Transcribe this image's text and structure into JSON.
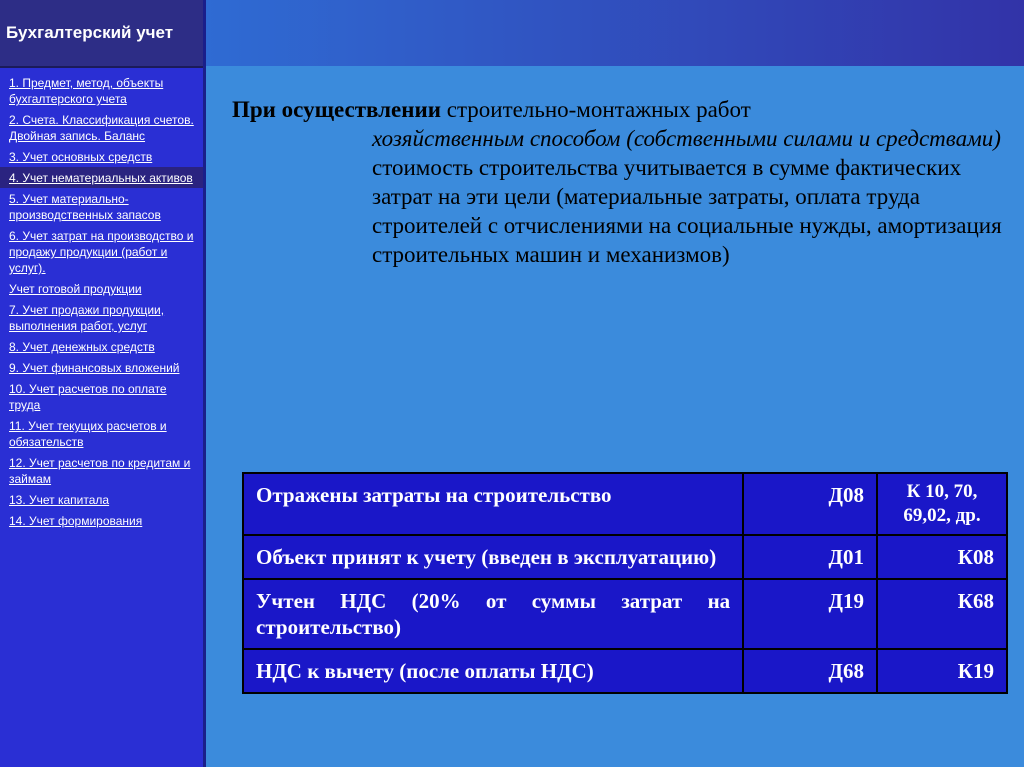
{
  "sidebar": {
    "title": "Бухгалтерский учет",
    "items": [
      {
        "label": "1. Предмет, метод, объекты бухгалтерского учета"
      },
      {
        "label": "2. Счета. Классификация счетов. Двойная запись. Баланс"
      },
      {
        "label": "3. Учет основных средств"
      },
      {
        "label": "4. Учет нематериальных активов"
      },
      {
        "label": "5. Учет материально-производственных запасов"
      },
      {
        "label": "6. Учет затрат на производство и продажу продукции (работ и услуг)."
      },
      {
        "label": " Учет готовой продукции"
      },
      {
        "label": "7. Учет продажи продукции, выполнения работ, услуг"
      },
      {
        "label": "8. Учет денежных средств"
      },
      {
        "label": "9. Учет финансовых вложений"
      },
      {
        "label": "10. Учет расчетов по оплате труда"
      },
      {
        "label": "11. Учет текущих расчетов и обязательств"
      },
      {
        "label": "12. Учет расчетов по кредитам и займам"
      },
      {
        "label": "13. Учет капитала"
      },
      {
        "label": "14. Учет формирования"
      }
    ]
  },
  "content": {
    "lead": "При осуществлении",
    "line1_rest": " строительно-монтажных работ",
    "italic_part": "хозяйственным способом (собственными силами и средствами)",
    "rest": " стоимость строительства учитывается в сумме фактических затрат на эти цели (материальные затраты, оплата труда строителей с отчислениями на социальные нужды, амортизация строительных машин и механизмов)"
  },
  "table": {
    "rows": [
      {
        "description": "Отражены затраты на строительство",
        "debit": "Д08",
        "credit": "К 10, 70, 69,02, др."
      },
      {
        "description": "Объект принят к учету (введен в эксплуатацию)",
        "debit": "Д01",
        "credit": "К08"
      },
      {
        "description": "Учтен НДС (20% от суммы затрат на строительство)",
        "debit": "Д19",
        "credit": "К68"
      },
      {
        "description": "НДС к вычету (после оплаты НДС)",
        "debit": "Д68",
        "credit": "К19"
      }
    ]
  },
  "colors": {
    "background": "#3b8bdc",
    "sidebar": "#2a2fd4",
    "sidebar_header": "#2d2d86",
    "table_fill": "#1a17c8"
  }
}
